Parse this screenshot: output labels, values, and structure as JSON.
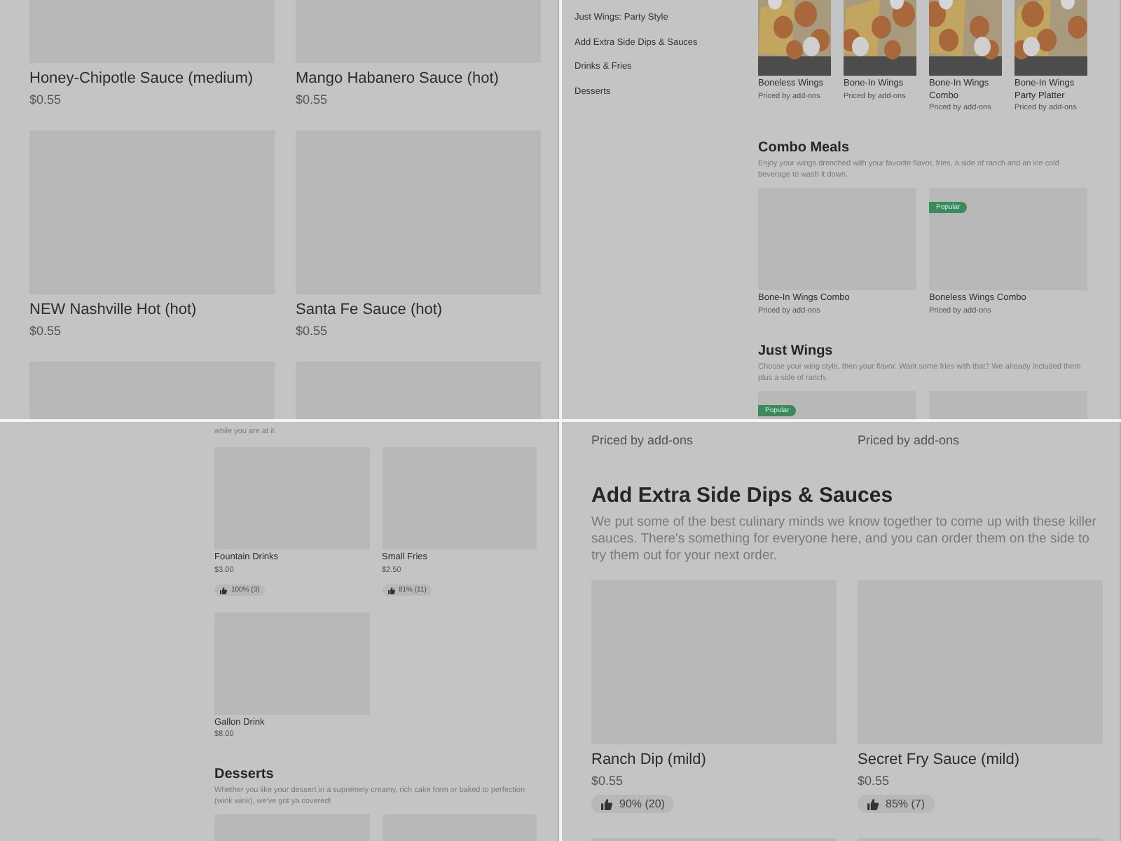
{
  "panels": [
    {
      "kind": "large",
      "blocks": [
        {
          "kind": "grid",
          "items": [
            {
              "kind": "card",
              "name": "Honey-Chipotle Sauce (medium)",
              "price": "$0.55"
            },
            {
              "kind": "card",
              "name": "Mango Habanero Sauce (hot)",
              "price": "$0.55"
            },
            {
              "kind": "card",
              "name": "NEW Nashville Hot (hot)",
              "price": "$0.55"
            },
            {
              "kind": "card",
              "name": "Santa Fe Sauce (hot)",
              "price": "$0.55"
            },
            {
              "kind": "image_only"
            },
            {
              "kind": "image_only"
            }
          ]
        }
      ]
    },
    {
      "kind": "compact",
      "sidebar": [
        {
          "label": "Just Wings: Party Style"
        },
        {
          "label": "Add Extra Side Dips & Sauces"
        },
        {
          "label": "Drinks & Fries"
        },
        {
          "label": "Desserts"
        }
      ],
      "blocks": [
        {
          "kind": "row4",
          "items": [
            {
              "kind": "card",
              "photo": true,
              "name": "Boneless Wings",
              "price": "Priced by add-ons"
            },
            {
              "kind": "card",
              "photo": true,
              "name": "Bone-In Wings",
              "price": "Priced by add-ons"
            },
            {
              "kind": "card",
              "photo": true,
              "name": "Bone-In Wings Combo",
              "price": "Priced by add-ons"
            },
            {
              "kind": "card",
              "photo": true,
              "name": "Bone-In Wings Party Platter",
              "price": "Priced by add-ons"
            }
          ]
        },
        {
          "kind": "section",
          "title": "Combo Meals",
          "description": "Enjoy your wings drenched with your favorite flavor, fries, a side of ranch and an ice cold beverage to wash it down."
        },
        {
          "kind": "grid",
          "items": [
            {
              "kind": "card",
              "name": "Bone-In Wings Combo",
              "price": "Priced by add-ons"
            },
            {
              "kind": "card",
              "badge": "Popular",
              "name": "Boneless Wings Combo",
              "price": "Priced by add-ons"
            }
          ]
        },
        {
          "kind": "section",
          "title": "Just Wings",
          "description": "Choose your wing style, then your flavor. Want some fries with that? We already included them plus a side of ranch."
        },
        {
          "kind": "grid",
          "items": [
            {
              "kind": "image_only",
              "badge": "Popular"
            },
            {
              "kind": "image_only"
            }
          ]
        }
      ]
    },
    {
      "kind": "compact",
      "blocks": [
        {
          "kind": "text",
          "text": "while you are at it"
        },
        {
          "kind": "grid",
          "items": [
            {
              "kind": "card",
              "name": "Fountain Drinks",
              "price": "$3.00",
              "rating": "100% (3)"
            },
            {
              "kind": "card",
              "name": "Small Fries",
              "price": "$2.50",
              "rating": "81% (11)"
            },
            {
              "kind": "card",
              "name": "Gallon Drink",
              "price": "$8.00"
            }
          ]
        },
        {
          "kind": "section",
          "title": "Desserts",
          "description": "Whether you like your dessert in a supremely creamy, rich cake form or baked to perfection (wink wink), we've got ya covered!"
        },
        {
          "kind": "grid",
          "items": [
            {
              "kind": "image_only"
            },
            {
              "kind": "image_only"
            }
          ]
        }
      ]
    },
    {
      "kind": "large",
      "blocks": [
        {
          "kind": "grid",
          "items": [
            {
              "kind": "price_only",
              "price": "Priced by add-ons"
            },
            {
              "kind": "price_only",
              "price": "Priced by add-ons"
            }
          ]
        },
        {
          "kind": "section",
          "title": "Add Extra Side Dips & Sauces",
          "description": "We put some of the best culinary minds we know together to come up with these killer sauces. There's something for everyone here, and you can order them on the side to try them out for your next order."
        },
        {
          "kind": "grid",
          "items": [
            {
              "kind": "card",
              "name": "Ranch Dip (mild)",
              "price": "$0.55",
              "rating": "90% (20)"
            },
            {
              "kind": "card",
              "name": "Secret Fry Sauce (mild)",
              "price": "$0.55",
              "rating": "85% (7)"
            },
            {
              "kind": "image_only"
            },
            {
              "kind": "image_only"
            }
          ]
        }
      ]
    }
  ]
}
